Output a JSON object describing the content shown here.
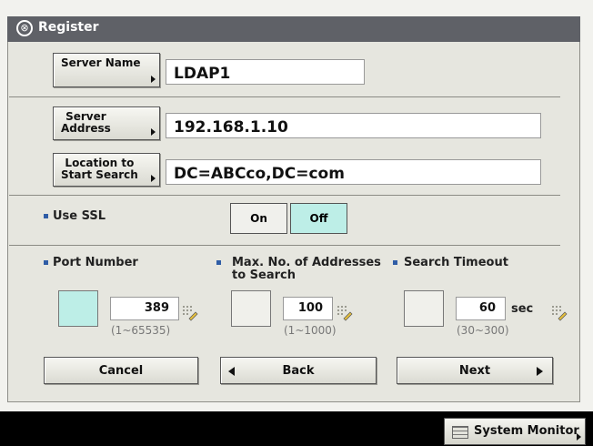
{
  "title": "Register",
  "title_icon": "registration-icon",
  "server_name": {
    "label": "Server Name",
    "value": "LDAP1"
  },
  "server_address": {
    "label": "Server\nAddress",
    "value": "192.168.1.10"
  },
  "location": {
    "label": "Location to\nStart Search",
    "value": "DC=ABCco,DC=com"
  },
  "ssl": {
    "label": "Use SSL",
    "on": "On",
    "off": "Off",
    "selected": "Off"
  },
  "port": {
    "label": "Port Number",
    "value": "389",
    "range": "(1~65535)"
  },
  "max_addresses": {
    "label": "Max. No. of Addresses\nto Search",
    "value": "100",
    "range": "(1~1000)"
  },
  "timeout": {
    "label": "Search Timeout",
    "value": "60",
    "unit": "sec",
    "range": "(30~300)"
  },
  "buttons": {
    "cancel": "Cancel",
    "back": "Back",
    "next": "Next"
  },
  "system_monitor": "System Monitor",
  "colors": {
    "title_bar": "#5f6167",
    "panel": "#e6e6df",
    "selected": "#bdeee7",
    "bullet": "#2f5da6"
  }
}
